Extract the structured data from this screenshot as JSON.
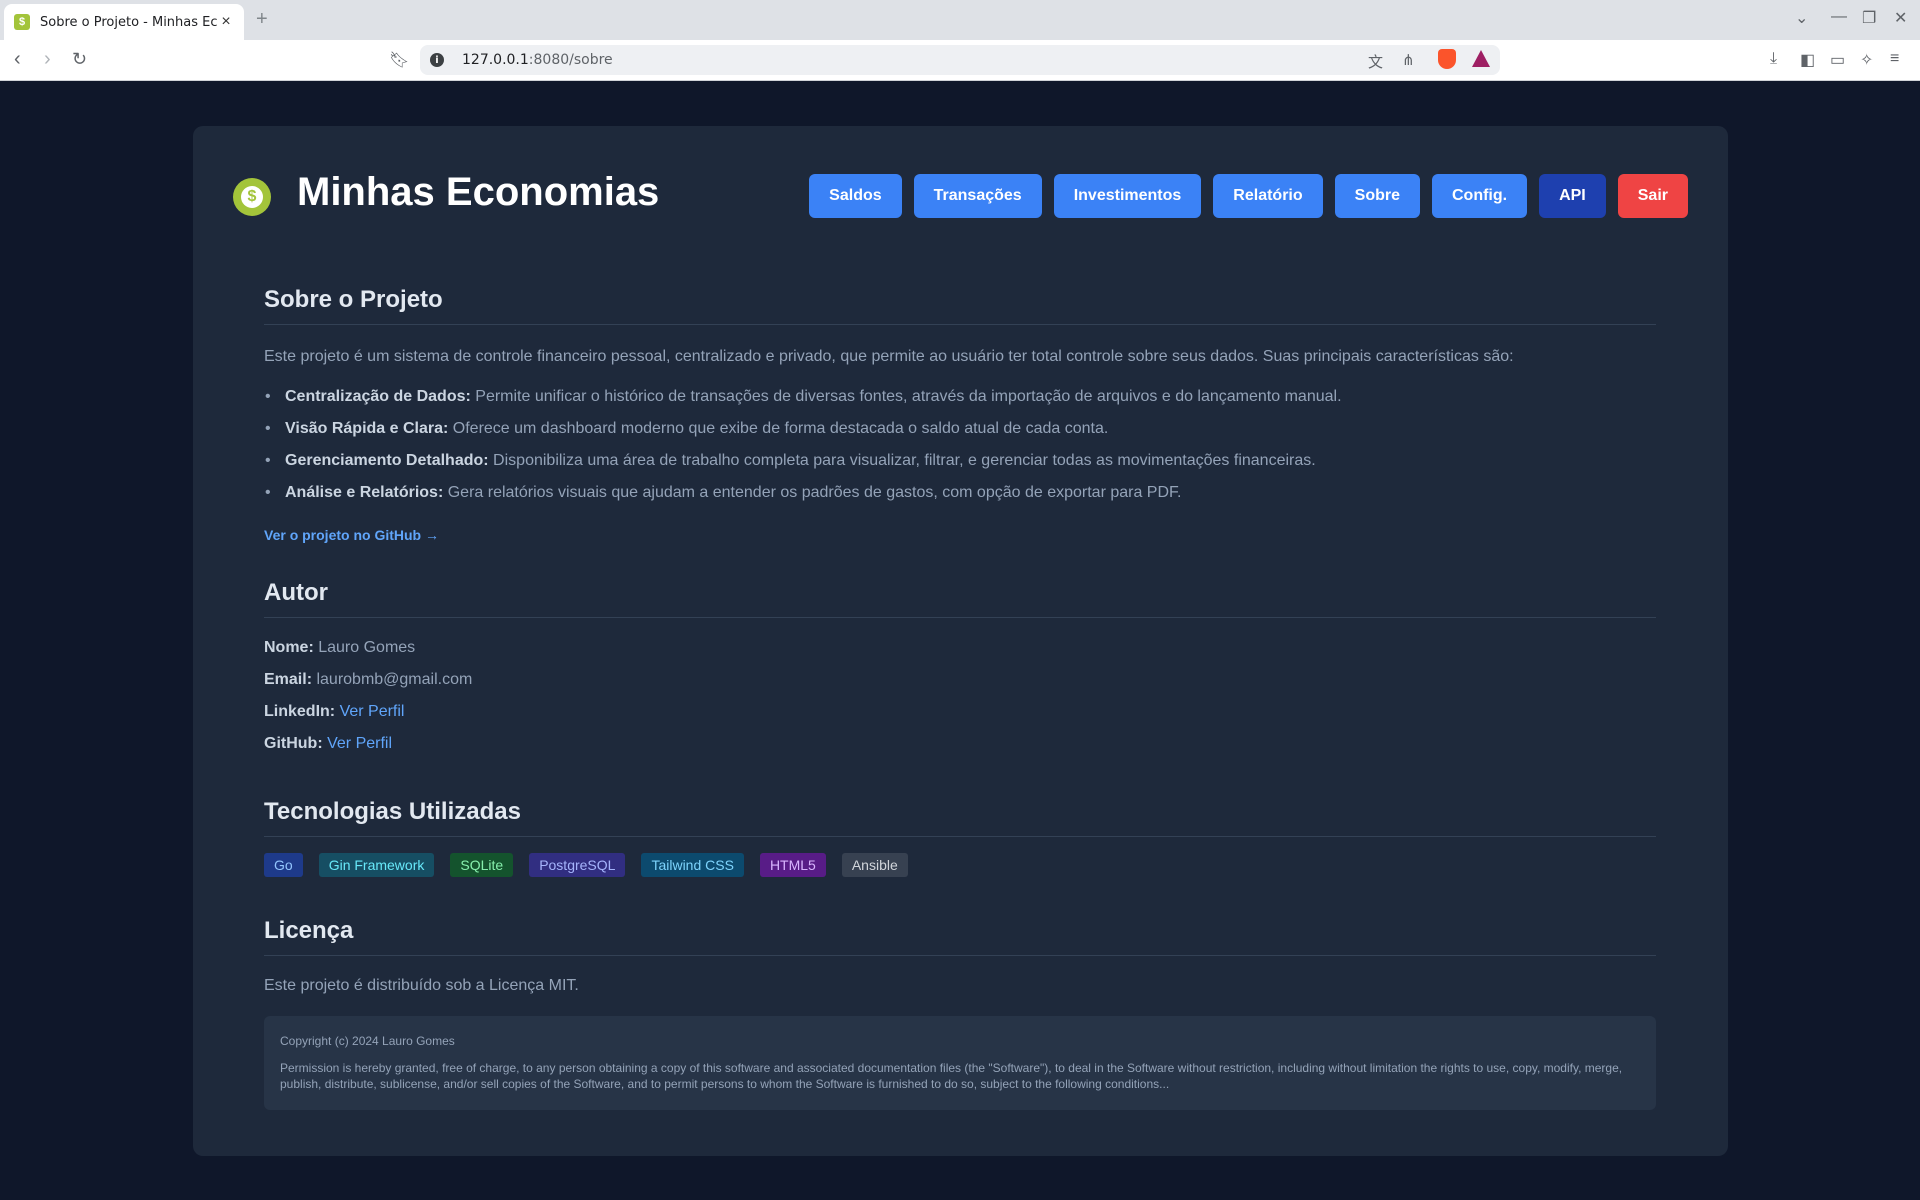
{
  "browser": {
    "tab_title": "Sobre o Projeto - Minhas Ec",
    "url_host": "127.0.0.1",
    "url_path": ":8080/sobre"
  },
  "header": {
    "app_title": "Minhas Economias",
    "logo_glyph": "$",
    "nav": [
      {
        "label": "Saldos"
      },
      {
        "label": "Transações"
      },
      {
        "label": "Investimentos"
      },
      {
        "label": "Relatório"
      },
      {
        "label": "Sobre"
      },
      {
        "label": "Config."
      },
      {
        "label": "API"
      },
      {
        "label": "Sair"
      }
    ]
  },
  "about": {
    "heading": "Sobre o Projeto",
    "intro": "Este projeto é um sistema de controle financeiro pessoal, centralizado e privado, que permite ao usuário ter total controle sobre seus dados. Suas principais características são:",
    "features": [
      {
        "title": "Centralização de Dados:",
        "text": " Permite unificar o histórico de transações de diversas fontes, através da importação de arquivos e do lançamento manual."
      },
      {
        "title": "Visão Rápida e Clara:",
        "text": " Oferece um dashboard moderno que exibe de forma destacada o saldo atual de cada conta."
      },
      {
        "title": "Gerenciamento Detalhado:",
        "text": " Disponibiliza uma área de trabalho completa para visualizar, filtrar, e gerenciar todas as movimentações financeiras."
      },
      {
        "title": "Análise e Relatórios:",
        "text": " Gera relatórios visuais que ajudam a entender os padrões de gastos, com opção de exportar para PDF."
      }
    ],
    "github_link": "Ver o projeto no GitHub →"
  },
  "author": {
    "heading": "Autor",
    "name_label": "Nome:",
    "name_value": " Lauro Gomes",
    "email_label": "Email:",
    "email_value": " laurobmb@gmail.com",
    "linkedin_label": "LinkedIn:",
    "linkedin_link": "Ver Perfil",
    "github_label": "GitHub:",
    "github_link": "Ver Perfil"
  },
  "tech": {
    "heading": "Tecnologias Utilizadas",
    "badges": [
      {
        "label": "Go",
        "bg": "#1e3a8a",
        "fg": "#93c5fd"
      },
      {
        "label": "Gin Framework",
        "bg": "#164e63",
        "fg": "#67e8f9"
      },
      {
        "label": "SQLite",
        "bg": "#14532d",
        "fg": "#86efac"
      },
      {
        "label": "PostgreSQL",
        "bg": "#312e81",
        "fg": "#a5b4fc"
      },
      {
        "label": "Tailwind CSS",
        "bg": "#0c4a6e",
        "fg": "#7dd3fc"
      },
      {
        "label": "HTML5",
        "bg": "#581c87",
        "fg": "#d8b4fe"
      },
      {
        "label": "Ansible",
        "bg": "#374151",
        "fg": "#d1d5db"
      }
    ]
  },
  "license": {
    "heading": "Licença",
    "text": "Este projeto é distribuído sob a Licença MIT.",
    "copyright": "Copyright (c) 2024 Lauro Gomes",
    "body": "Permission is hereby granted, free of charge, to any person obtaining a copy of this software and associated documentation files (the \"Software\"), to deal in the Software without restriction, including without limitation the rights to use, copy, modify, merge, publish, distribute, sublicense, and/or sell copies of the Software, and to permit persons to whom the Software is furnished to do so, subject to the following conditions..."
  },
  "colors": {
    "background": "#0f172a",
    "card": "#1e293b",
    "primary_button": "#3b82f6",
    "api_button": "#1e40af",
    "logout_button": "#ef4444",
    "link": "#60a5fa",
    "logo": "#a3c43a"
  }
}
